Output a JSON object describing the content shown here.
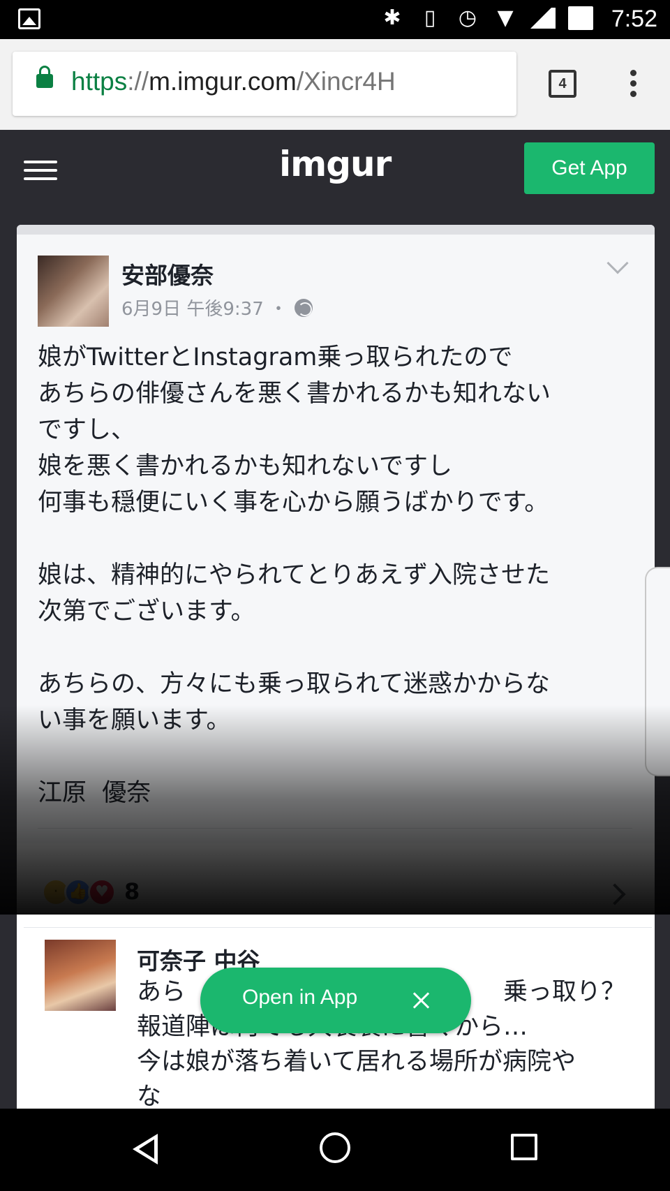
{
  "status_bar": {
    "time": "7:52",
    "icons": [
      "gallery-icon",
      "bluetooth-icon",
      "vibrate-icon",
      "alarm-icon",
      "wifi-icon",
      "signal-icon",
      "battery-icon"
    ]
  },
  "browser": {
    "url_scheme": "https",
    "url_separator": "://",
    "url_host": "m.imgur.com",
    "url_path": "/Xincr4H",
    "tab_count": "4"
  },
  "imgur_header": {
    "logo": "imgur",
    "get_app_label": "Get App"
  },
  "post": {
    "author": "安部優奈",
    "meta": "6月9日 午後9:37 ・",
    "body": "娘がTwitterとInstagram乗っ取られたので\nあちらの俳優さんを悪く書かれるかも知れない\nですし、\n娘を悪く書かれるかも知れないですし\n何事も穏便にいく事を心から願うばかりです。\n\n娘は、精神的にやられてとりあえず入院させた\n次第でございます。\n\nあちらの、方々にも乗っ取られて迷惑かからな\nい事を願います。\n\n江原  優奈",
    "reaction_count": "8",
    "reactions": [
      "sad-icon",
      "like-icon",
      "love-icon"
    ]
  },
  "comment": {
    "author": "可奈子 中谷",
    "body": "あら　　　　　　　　　　　　　乗っ取り？\n報道陣は何でも大袈裟に書くから…\n今は娘が落ち着いて居れる場所が病院や\nな"
  },
  "open_in_app": {
    "label": "Open in App"
  },
  "colors": {
    "imgur_dark": "#2b2b31",
    "imgur_green": "#1bb76e",
    "secure_green": "#0b8043"
  }
}
